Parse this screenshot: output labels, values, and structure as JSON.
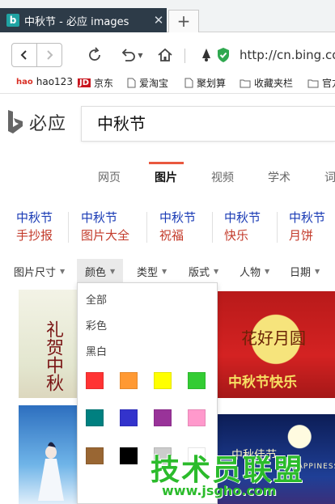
{
  "browser": {
    "tab_title": "中秋节 - 必应 images",
    "tab_icon_letter": "b",
    "tab_close": "✕",
    "new_tab": "+",
    "url": "http://cn.bing.com"
  },
  "bookmarks": [
    {
      "label": "hao123",
      "icon": "hao123-icon"
    },
    {
      "label": "京东",
      "icon": "jd-icon"
    },
    {
      "label": "爱淘宝",
      "icon": "page-icon"
    },
    {
      "label": "聚划算",
      "icon": "page-icon"
    },
    {
      "label": "收藏夹栏",
      "icon": "folder-icon"
    },
    {
      "label": "官方",
      "icon": "folder-icon"
    }
  ],
  "bookmark_badges": {
    "hao": "hao",
    "jd": "JD"
  },
  "bing": {
    "logo_text": "必应",
    "query": "中秋节"
  },
  "scopes": [
    {
      "label": "网页",
      "active": false
    },
    {
      "label": "图片",
      "active": true
    },
    {
      "label": "视频",
      "active": false
    },
    {
      "label": "学术",
      "active": false
    },
    {
      "label": "词",
      "active": false
    }
  ],
  "related": [
    {
      "line1": "中秋节",
      "line2": "手抄报"
    },
    {
      "line1": "中秋节",
      "line2": "图片大全"
    },
    {
      "line1": "中秋节",
      "line2": "祝福"
    },
    {
      "line1": "中秋节",
      "line2": "快乐"
    },
    {
      "line1": "中秋节",
      "line2": "月饼"
    }
  ],
  "filters": [
    {
      "label": "图片尺寸",
      "open": false
    },
    {
      "label": "颜色",
      "open": true
    },
    {
      "label": "类型",
      "open": false
    },
    {
      "label": "版式",
      "open": false
    },
    {
      "label": "人物",
      "open": false
    },
    {
      "label": "日期",
      "open": false
    }
  ],
  "color_menu": {
    "options": [
      "全部",
      "彩色",
      "黑白"
    ],
    "swatches": [
      "#ff3333",
      "#ff9933",
      "#ffff00",
      "#33cc33",
      "#008080",
      "#3333cc",
      "#993399",
      "#ff99cc",
      "#996633",
      "#000000",
      "#cccccc",
      "#ffffff"
    ]
  },
  "thumbnails": {
    "t1_caption": "礼贺中秋",
    "t2_caption_1": "花好月圆",
    "t2_caption_2": "中秋节快乐",
    "t4_caption": "中秋佳节",
    "t4_sub": "HAPPINESS"
  },
  "watermark": {
    "text": "技术员联盟",
    "url": "www.jsgho.com"
  }
}
